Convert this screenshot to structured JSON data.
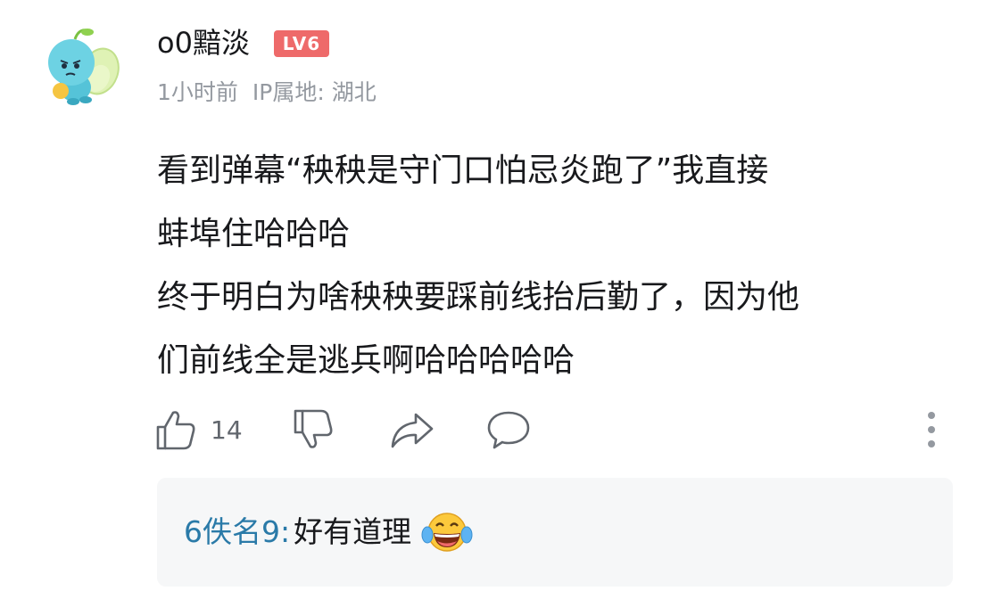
{
  "comment": {
    "username": "o0黯淡",
    "level_badge": "LV6",
    "time": "1小时前",
    "ip_location": "IP属地: 湖北",
    "content_lines": [
      "看到弹幕“秧秧是守门口怕忌炎跑了”我直接",
      "蚌埠住哈哈哈",
      "终于明白为啥秧秧要踩前线抬后勤了，因为他",
      "们前线全是逃兵啊哈哈哈哈哈"
    ],
    "like_count": "14"
  },
  "reply": {
    "username": "6佚名9:",
    "text": "好有道理",
    "emoji": "laughing-tears-emoji"
  },
  "icons": {
    "like": "thumbs-up-icon",
    "dislike": "thumbs-down-icon",
    "share": "share-icon",
    "reply": "comment-icon",
    "more": "more-vertical-icon"
  },
  "colors": {
    "level_badge": "#ee6a6a",
    "reply_username": "#2a7aa8",
    "meta_text": "#9499a0",
    "reply_bg": "#f6f7f8"
  }
}
